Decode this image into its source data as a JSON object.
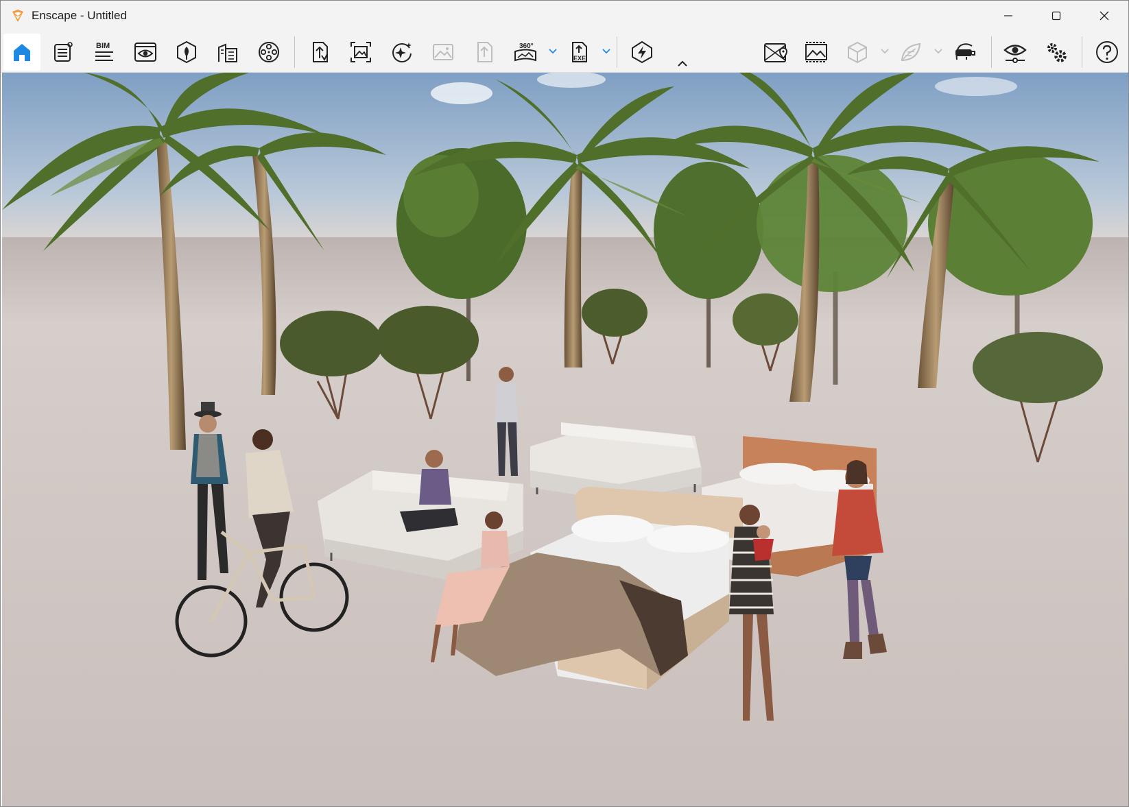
{
  "window": {
    "title": "Enscape - Untitled",
    "logo_icon": "enscape-logo-icon",
    "controls": [
      "minimize-icon",
      "maximize-icon",
      "close-icon"
    ]
  },
  "toolbar": {
    "accent_color": "#1e88e5",
    "bim_label": "BIM",
    "pano_label": "360°",
    "exe_label": "EXE",
    "buttons": [
      {
        "name": "home-button",
        "icon": "home-icon",
        "active": true
      },
      {
        "name": "notes-button",
        "icon": "document-icon"
      },
      {
        "name": "bim-button",
        "icon": "bim-icon"
      },
      {
        "name": "views-button",
        "icon": "view-window-icon"
      },
      {
        "name": "assets-button",
        "icon": "asset-library-icon"
      },
      {
        "name": "site-context-button",
        "icon": "buildings-icon"
      },
      {
        "name": "video-editor-button",
        "icon": "film-reel-icon"
      },
      {
        "name": "export-file-button",
        "icon": "file-export-icon"
      },
      {
        "name": "screenshot-button",
        "icon": "screenshot-icon"
      },
      {
        "name": "ai-enhancer-button",
        "icon": "sparkle-icon"
      },
      {
        "name": "render-gallery-button",
        "icon": "image-icon",
        "disabled": true
      },
      {
        "name": "upload-button",
        "icon": "upload-icon",
        "disabled": true
      },
      {
        "name": "panorama-button",
        "icon": "panorama-360-icon"
      },
      {
        "name": "exe-export-button",
        "icon": "exe-export-icon"
      },
      {
        "name": "live-updates-button",
        "icon": "lightning-icon"
      },
      {
        "name": "collapse-toolbar-button",
        "icon": "chevron-up-icon"
      },
      {
        "name": "map-button",
        "icon": "map-pin-icon"
      },
      {
        "name": "atmosphere-button",
        "icon": "landscape-icon"
      },
      {
        "name": "section-box-button",
        "icon": "cube-icon",
        "disabled": true
      },
      {
        "name": "material-button",
        "icon": "leaf-icon",
        "disabled": true
      },
      {
        "name": "vr-headset-button",
        "icon": "vr-headset-icon"
      },
      {
        "name": "visual-settings-button",
        "icon": "eye-slider-icon"
      },
      {
        "name": "general-settings-button",
        "icon": "gears-icon"
      },
      {
        "name": "help-button",
        "icon": "help-icon"
      }
    ]
  },
  "scene": {
    "description_icon": "render-viewport",
    "sky_color": "#9cb4cc",
    "ground_color": "#cfc6c3"
  }
}
